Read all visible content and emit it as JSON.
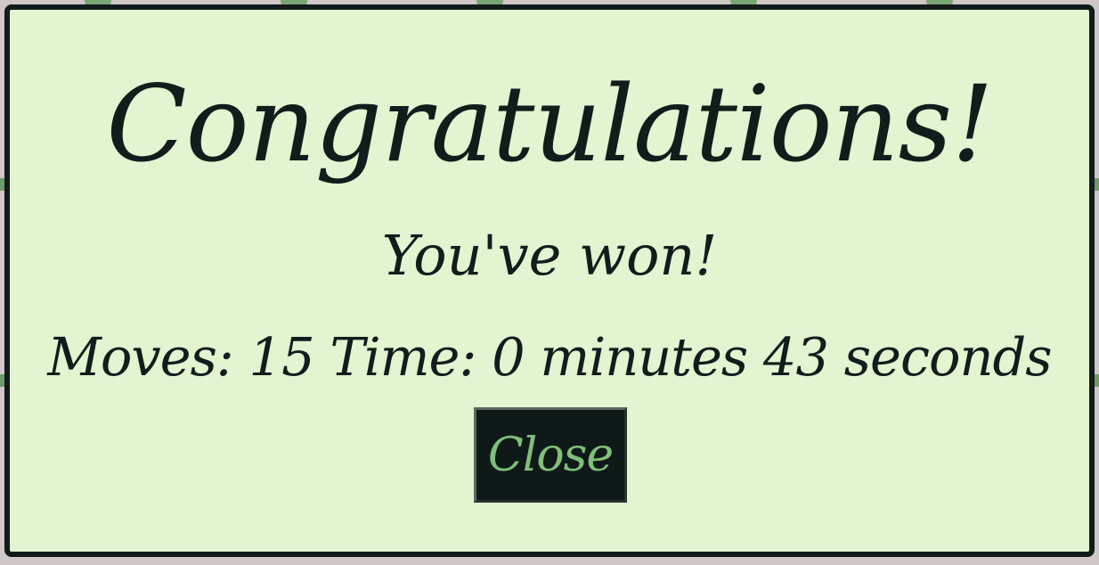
{
  "modal": {
    "title": "Congratulations!",
    "subtitle": "You've won!",
    "stats": {
      "moves_label": "Moves:",
      "moves_value": "15",
      "time_label": "Time:",
      "minutes_value": "0",
      "minutes_label": "minutes",
      "seconds_value": "43",
      "seconds_label": "seconds"
    },
    "close_label": "Close"
  },
  "colors": {
    "modal_background": "#e2f4d0",
    "modal_border": "#111b19",
    "text": "#121c1a",
    "button_background": "#0f1a18",
    "button_text": "#7fbf7a"
  }
}
